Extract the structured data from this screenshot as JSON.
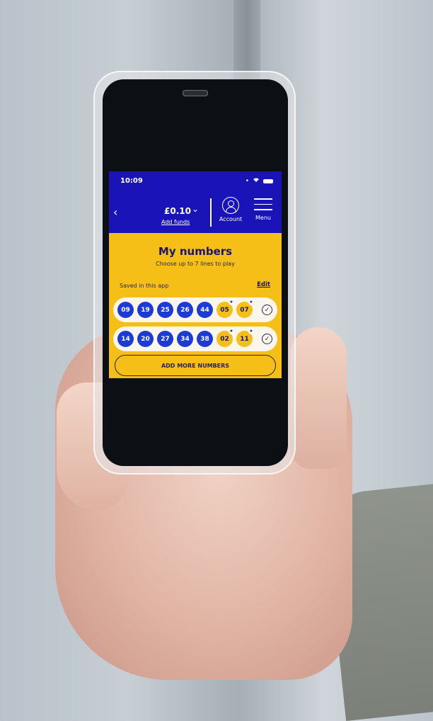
{
  "status_bar": {
    "time": "10:09",
    "wifi_icon": "wifi-icon",
    "battery_icon": "battery-icon"
  },
  "header": {
    "back_icon": "chevron-left-icon",
    "balance": "£0.10",
    "balance_chevron": "chevron-down-icon",
    "add_funds_label": "Add funds",
    "account_label": "Account",
    "menu_label": "Menu"
  },
  "main": {
    "title": "My numbers",
    "subtitle": "Choose up to 7 lines to play",
    "saved_label": "Saved in this app",
    "edit_label": "Edit",
    "lines": [
      {
        "main": [
          "09",
          "19",
          "25",
          "26",
          "44"
        ],
        "stars": [
          "05",
          "07"
        ],
        "selected": true
      },
      {
        "main": [
          "14",
          "20",
          "27",
          "34",
          "38"
        ],
        "stars": [
          "02",
          "11"
        ],
        "selected": true
      }
    ],
    "add_more_label": "ADD MORE NUMBERS"
  },
  "colors": {
    "brand_blue": "#1a14b8",
    "ball_blue": "#1b3ad6",
    "panel_yellow": "#f5bf18",
    "text_navy": "#1d1470"
  },
  "glyphs": {
    "back": "‹",
    "chevron": "⌄",
    "star": "★",
    "check": "✓",
    "dot": "•"
  }
}
